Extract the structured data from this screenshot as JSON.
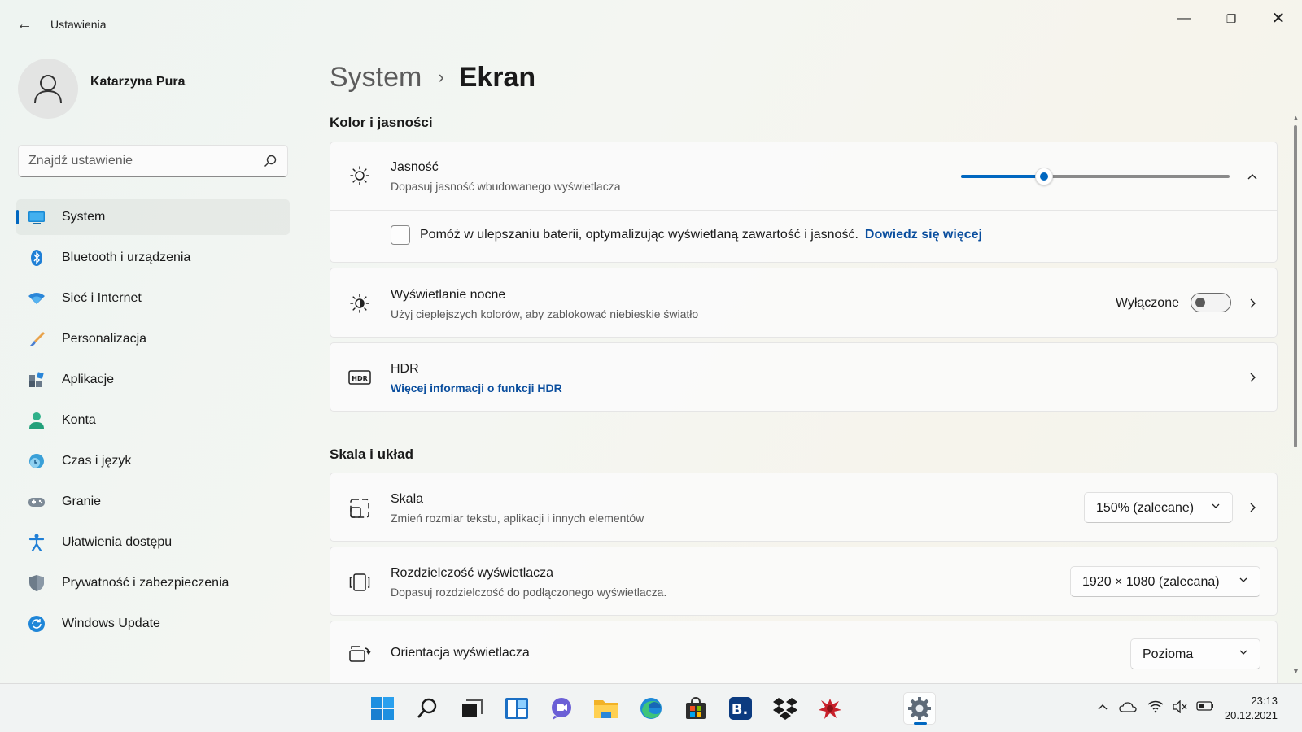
{
  "window": {
    "title": "Ustawienia"
  },
  "profile": {
    "name": "Katarzyna Pura"
  },
  "search": {
    "placeholder": "Znajdź ustawienie"
  },
  "sidebar": {
    "items": [
      {
        "label": "System",
        "icon": "display-icon",
        "active": true
      },
      {
        "label": "Bluetooth i urządzenia",
        "icon": "bluetooth-icon"
      },
      {
        "label": "Sieć i Internet",
        "icon": "wifi-icon"
      },
      {
        "label": "Personalizacja",
        "icon": "brush-icon"
      },
      {
        "label": "Aplikacje",
        "icon": "apps-icon"
      },
      {
        "label": "Konta",
        "icon": "account-icon"
      },
      {
        "label": "Czas i język",
        "icon": "time-language-icon"
      },
      {
        "label": "Granie",
        "icon": "gamepad-icon"
      },
      {
        "label": "Ułatwienia dostępu",
        "icon": "accessibility-icon"
      },
      {
        "label": "Prywatność i zabezpieczenia",
        "icon": "shield-icon"
      },
      {
        "label": "Windows Update",
        "icon": "update-icon"
      }
    ]
  },
  "breadcrumb": {
    "parent": "System",
    "separator": "›",
    "current": "Ekran"
  },
  "sections": {
    "color": "Kolor i jasności",
    "scale": "Skala i układ"
  },
  "brightness": {
    "title": "Jasność",
    "subtitle": "Dopasuj jasność wbudowanego wyświetlacza",
    "value_fraction": 0.31
  },
  "battery": {
    "label": "Pomóż w ulepszaniu baterii, optymalizując wyświetlaną zawartość i jasność.",
    "link": "Dowiedz się więcej",
    "checked": false
  },
  "night_light": {
    "title": "Wyświetlanie nocne",
    "subtitle": "Użyj cieplejszych kolorów, aby zablokować niebieskie światło",
    "state": "Wyłączone"
  },
  "hdr": {
    "title": "HDR",
    "link": "Więcej informacji o funkcji HDR"
  },
  "scale": {
    "title": "Skala",
    "subtitle": "Zmień rozmiar tekstu, aplikacji i innych elementów",
    "value": "150% (zalecane)"
  },
  "resolution": {
    "title": "Rozdzielczość wyświetlacza",
    "subtitle": "Dopasuj rozdzielczość do podłączonego wyświetlacza.",
    "value": "1920 × 1080 (zalecana)"
  },
  "orientation": {
    "title": "Orientacja wyświetlacza",
    "value": "Pozioma"
  },
  "taskbar": {
    "time": "23:13",
    "date": "20.12.2021"
  },
  "colors": {
    "accent": "#0067c0",
    "link": "#0a4e9e"
  }
}
